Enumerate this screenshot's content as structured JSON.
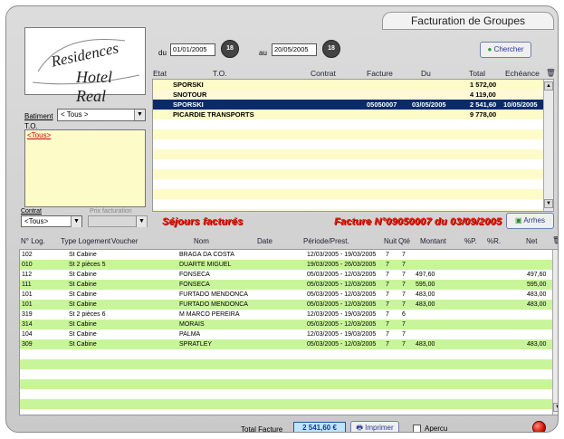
{
  "window": {
    "title": "Facturation de Groupes"
  },
  "logo": {
    "line1": "Residences",
    "line2": "Hotel Real"
  },
  "filters": {
    "batiment_label": "Batiment",
    "batiment_value": "< Tous >",
    "to_label": "T.O.",
    "to_list_item": "<Tous>"
  },
  "dates": {
    "du_label": "du",
    "du_value": "01/01/2005",
    "au_label": "au",
    "au_value": "20/05/2005",
    "search_label": "Chercher"
  },
  "grid1": {
    "headers": {
      "etat": "Etat",
      "to": "T.O.",
      "contrat": "Contrat",
      "facture": "Facture",
      "du": "Du",
      "total": "Total",
      "echeance": "Echéance"
    },
    "rows": [
      {
        "to": "SPORSKI",
        "contrat": "",
        "facture": "",
        "du": "",
        "total": "1 572,00",
        "echeance": "",
        "style": "alt"
      },
      {
        "to": "SNOTOUR",
        "contrat": "",
        "facture": "",
        "du": "",
        "total": "4 119,00",
        "echeance": "",
        "style": "alt2"
      },
      {
        "to": "SPORSKI",
        "contrat": "",
        "facture": "05050007",
        "du": "03/05/2005",
        "total": "2 541,60",
        "echeance": "10/05/2005",
        "style": "sel"
      },
      {
        "to": "PICARDIE TRANSPORTS",
        "contrat": "",
        "facture": "",
        "du": "",
        "total": "9 778,00",
        "echeance": "",
        "style": "alt"
      }
    ]
  },
  "middle": {
    "contrat_label": "Contrat",
    "contrat_value": "<Tous>",
    "second_label": "Prix facturation",
    "sejours_title": "Séjours facturés",
    "facture_title": "Facture N°09050007 du 03/09/2005",
    "arrhes_label": "Arrhes"
  },
  "grid2": {
    "headers": {
      "nlog": "N° Log.",
      "type": "Type Logement",
      "voucher": "Voucher",
      "nom": "Nom",
      "date": "Date",
      "periode": "Période/Prest.",
      "nuit": "Nuit",
      "qte": "Qté",
      "montant": "Montant",
      "pct1": "%P.",
      "pct2": "%R.",
      "net": "Net"
    },
    "rows": [
      {
        "nlog": "102",
        "type": "St Cabine",
        "nom": "BRAGA DA COSTA",
        "periode": "12/03/2005 - 19/03/2005",
        "nuit": "7",
        "qte": "7",
        "montant": "",
        "net": ""
      },
      {
        "nlog": "010",
        "type": "St 2 pièces 5",
        "nom": "DUARTE MIGUEL",
        "periode": "19/03/2005 - 26/03/2005",
        "nuit": "7",
        "qte": "7",
        "montant": "",
        "net": ""
      },
      {
        "nlog": "112",
        "type": "St Cabine",
        "nom": "FONSECA",
        "periode": "05/03/2005 - 12/03/2005",
        "nuit": "7",
        "qte": "7",
        "montant": "497,60",
        "net": "497,60"
      },
      {
        "nlog": "111",
        "type": "St Cabine",
        "nom": "FONSECA",
        "periode": "05/03/2005 - 12/03/2005",
        "nuit": "7",
        "qte": "7",
        "montant": "595,00",
        "net": "595,00"
      },
      {
        "nlog": "101",
        "type": "St Cabine",
        "nom": "FURTADO MENDONCA",
        "periode": "05/03/2005 - 12/03/2005",
        "nuit": "7",
        "qte": "7",
        "montant": "483,00",
        "net": "483,00"
      },
      {
        "nlog": "101",
        "type": "St Cabine",
        "nom": "FURTADO MENDONCA",
        "periode": "05/03/2005 - 12/03/2005",
        "nuit": "7",
        "qte": "7",
        "montant": "483,00",
        "net": "483,00"
      },
      {
        "nlog": "319",
        "type": "St 2 pièces 6",
        "nom": "M MARCO PEREIRA",
        "periode": "12/03/2005 - 19/03/2005",
        "nuit": "7",
        "qte": "6",
        "montant": "",
        "net": ""
      },
      {
        "nlog": "314",
        "type": "St Cabine",
        "nom": "MORAIS",
        "periode": "05/03/2005 - 12/03/2005",
        "nuit": "7",
        "qte": "7",
        "montant": "",
        "net": ""
      },
      {
        "nlog": "104",
        "type": "St Cabine",
        "nom": "PALMA",
        "periode": "12/03/2005 - 19/03/2005",
        "nuit": "7",
        "qte": "7",
        "montant": "",
        "net": ""
      },
      {
        "nlog": "309",
        "type": "St Cabine",
        "nom": "SPRATLEY",
        "periode": "05/03/2005 - 12/03/2005",
        "nuit": "7",
        "qte": "7",
        "montant": "483,00",
        "net": "483,00"
      }
    ]
  },
  "footer": {
    "total_label": "Total Facture",
    "total_value": "2 541,60 €",
    "print_label": "Imprimer",
    "apercu_label": "Apercu"
  },
  "colors": {
    "selected_row": "#0a2a6b",
    "green_row": "#c8f59a",
    "yellow_row": "#fdfbc8",
    "red_title": "#e2230b",
    "total_box": "#bfe4ff"
  }
}
